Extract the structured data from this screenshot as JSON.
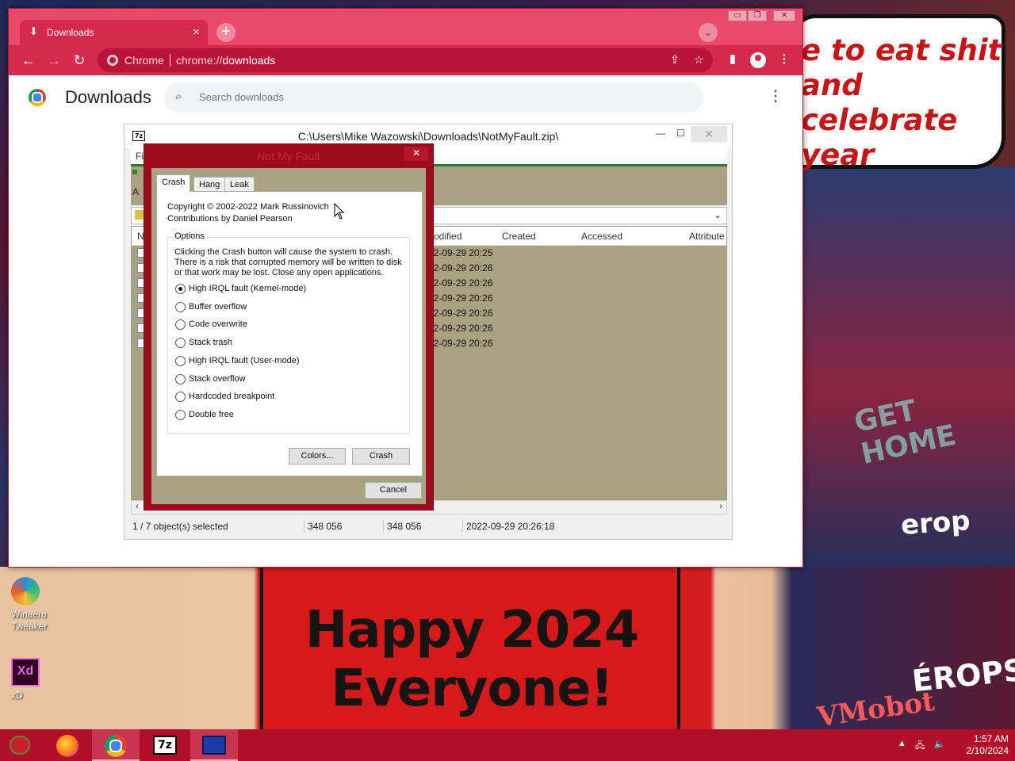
{
  "wallpaper": {
    "speech": "e to eat shit and celebrate year",
    "happy_line1": "Happy 2024",
    "happy_line2": "Everyone!",
    "sign_cmp": "erop",
    "sign_cmp2": "ÉROPS",
    "sign_vm": "VMobot",
    "sign_home": "GET HOME"
  },
  "desktop_icons": [
    {
      "label": "Winaero Tweaker",
      "icon": "winaero-tweaker-icon"
    },
    {
      "label": "xD",
      "icon": "adobe-xd-icon"
    }
  ],
  "chrome": {
    "tab_title": "Downloads",
    "tab_icon": "download-icon",
    "new_tab": "+",
    "omnibox_site": "Chrome",
    "omnibox_url_prefix": "chrome://",
    "omnibox_url_path": "downloads",
    "page_title": "Downloads",
    "search_placeholder": "Search downloads",
    "accent": "#d52a4c",
    "titlebar_color": "#e94a69"
  },
  "zip": {
    "title": "C:\\Users\\Mike Wazowski\\Downloads\\NotMyFault.zip\\",
    "menu_visible": "Fi",
    "toolbar_visible": "A",
    "columns": {
      "name": "N",
      "modified": "odified",
      "created": "Created",
      "accessed": "Accessed",
      "attributes": "Attribute"
    },
    "rows": [
      {
        "modified": "22-09-29 20:25"
      },
      {
        "modified": "22-09-29 20:26"
      },
      {
        "modified": "22-09-29 20:26"
      },
      {
        "modified": "22-09-29 20:26"
      },
      {
        "modified": "22-09-29 20:26"
      },
      {
        "modified": "22-09-29 20:26"
      },
      {
        "modified": "22-09-29 20:26"
      }
    ],
    "status": {
      "selected": "1 / 7 object(s) selected",
      "size": "348 056",
      "packed": "348 056",
      "date": "2022-09-29 20:26:18"
    }
  },
  "nmf": {
    "title": "Not My Fault",
    "tabs": [
      "Crash",
      "Hang",
      "Leak"
    ],
    "active_tab": "Crash",
    "copyright": "Copyright © 2002-2022 Mark Russinovich",
    "contributions": "Contributions by Daniel Pearson",
    "options_label": "Options",
    "description": "Clicking the Crash button will cause the system to crash. There is a risk that corrupted memory will be written to disk or that work may be lost. Close any open applications.",
    "options": [
      {
        "label": "High IRQL fault (Kernel-mode)",
        "selected": true
      },
      {
        "label": "Buffer overflow",
        "selected": false
      },
      {
        "label": "Code overwrite",
        "selected": false
      },
      {
        "label": "Stack trash",
        "selected": false
      },
      {
        "label": "High IRQL fault (User-mode)",
        "selected": false
      },
      {
        "label": "Stack overflow",
        "selected": false
      },
      {
        "label": "Hardcoded breakpoint",
        "selected": false
      },
      {
        "label": "Double free",
        "selected": false
      }
    ],
    "colors_button": "Colors...",
    "crash_button": "Crash",
    "cancel_button": "Cancel"
  },
  "taskbar": {
    "apps": [
      {
        "name": "firefox",
        "icon": "firefox-icon"
      },
      {
        "name": "chrome",
        "icon": "chrome-icon",
        "active": true
      },
      {
        "name": "7-zip",
        "icon": "7zip-icon",
        "label": "7z"
      },
      {
        "name": "notmyfault",
        "icon": "notmyfault-icon"
      }
    ],
    "time": "1:57 AM",
    "date": "2/10/2024"
  }
}
